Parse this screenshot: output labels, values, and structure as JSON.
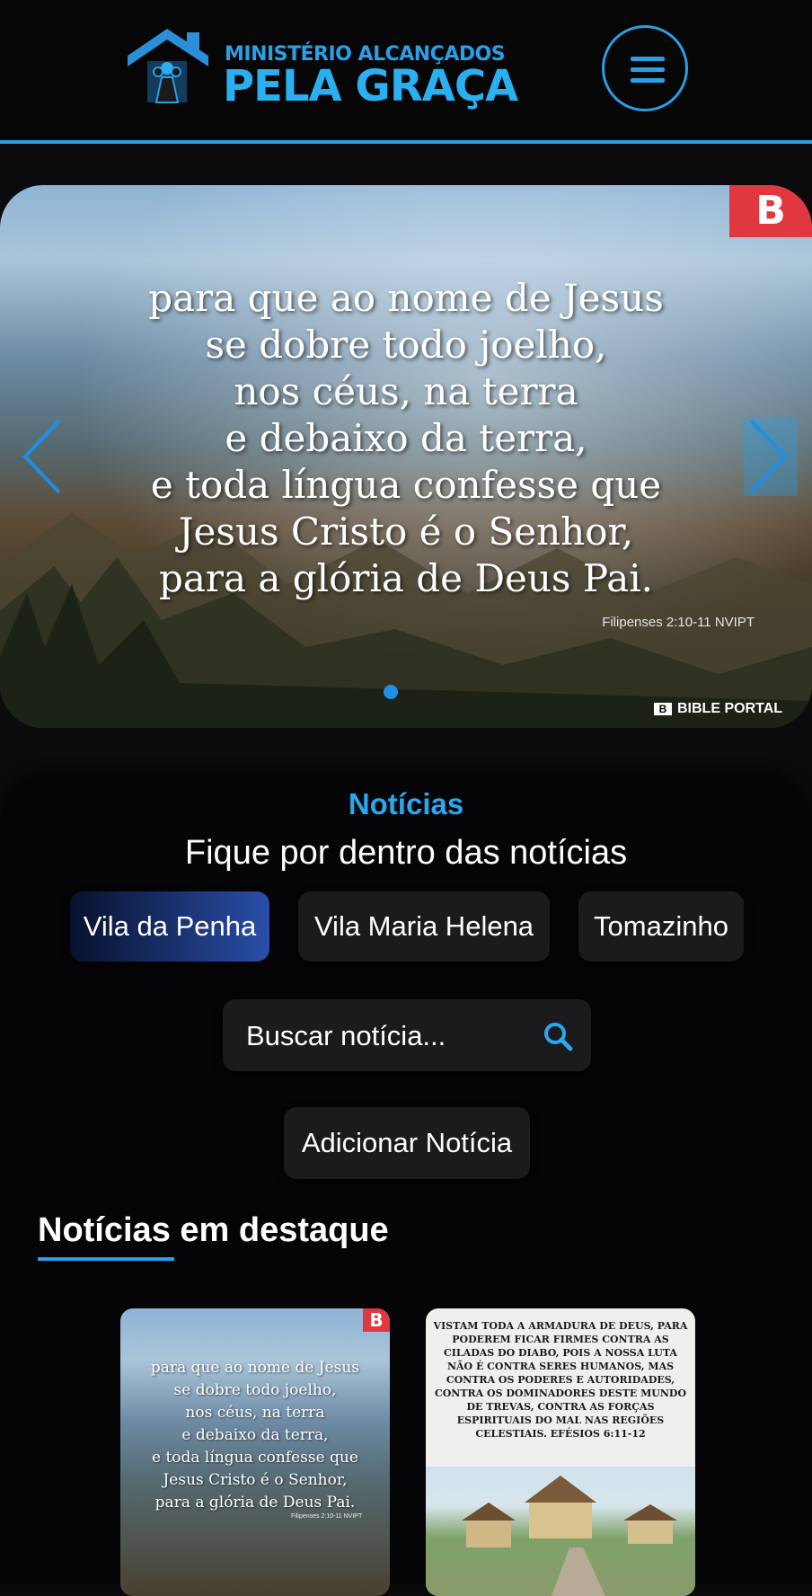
{
  "header": {
    "logo_small": "MINISTÉRIO ALCANÇADOS",
    "logo_big": "PELA GRAÇA",
    "menu_icon": "hamburger-menu-icon"
  },
  "carousel": {
    "badge": "B",
    "verse_lines": [
      "para que ao nome de Jesus",
      "se dobre todo joelho,",
      "nos céus, na terra",
      "e debaixo da terra,",
      "e toda língua confesse que",
      "Jesus Cristo é o Senhor,",
      "para a glória de Deus Pai."
    ],
    "reference": "Filipenses 2:10-11 NVIPT",
    "watermark_logo": "B",
    "watermark": "BIBLE PORTAL",
    "active_slide": 1,
    "slide_count": 1
  },
  "news": {
    "title": "Notícias",
    "subtitle": "Fique por dentro das notícias",
    "filters": [
      "Vila da Penha",
      "Vila Maria Helena",
      "Tomazinho"
    ],
    "active_filter": "Vila da Penha",
    "search_placeholder": "Buscar notícia...",
    "add_button": "Adicionar Notícia",
    "featured_title_1": "Notícias",
    "featured_title_2": "em destaque"
  },
  "cards": [
    {
      "badge": "B",
      "verse_lines": [
        "para que ao nome de Jesus",
        "se dobre todo joelho,",
        "nos céus, na terra",
        "e debaixo da terra,",
        "e toda língua confesse que",
        "Jesus Cristo é o Senhor,",
        "para a glória de Deus Pai."
      ],
      "reference": "Filipenses 2:10-11 NVIPT"
    },
    {
      "text": "Vistam toda a armadura de Deus, para poderem ficar firmes contra as ciladas do Diabo, pois a nossa luta não é contra seres humanos, mas contra os poderes e autoridades, contra os dominadores deste mundo de trevas, contra as forças espirituais do mal nas regiões celestiais. Efésios 6:11-12"
    }
  ],
  "colors": {
    "accent": "#2a9fe6",
    "background": "#0b0b0d",
    "chip": "#1b1b1e",
    "badge_red": "#e0383e"
  }
}
